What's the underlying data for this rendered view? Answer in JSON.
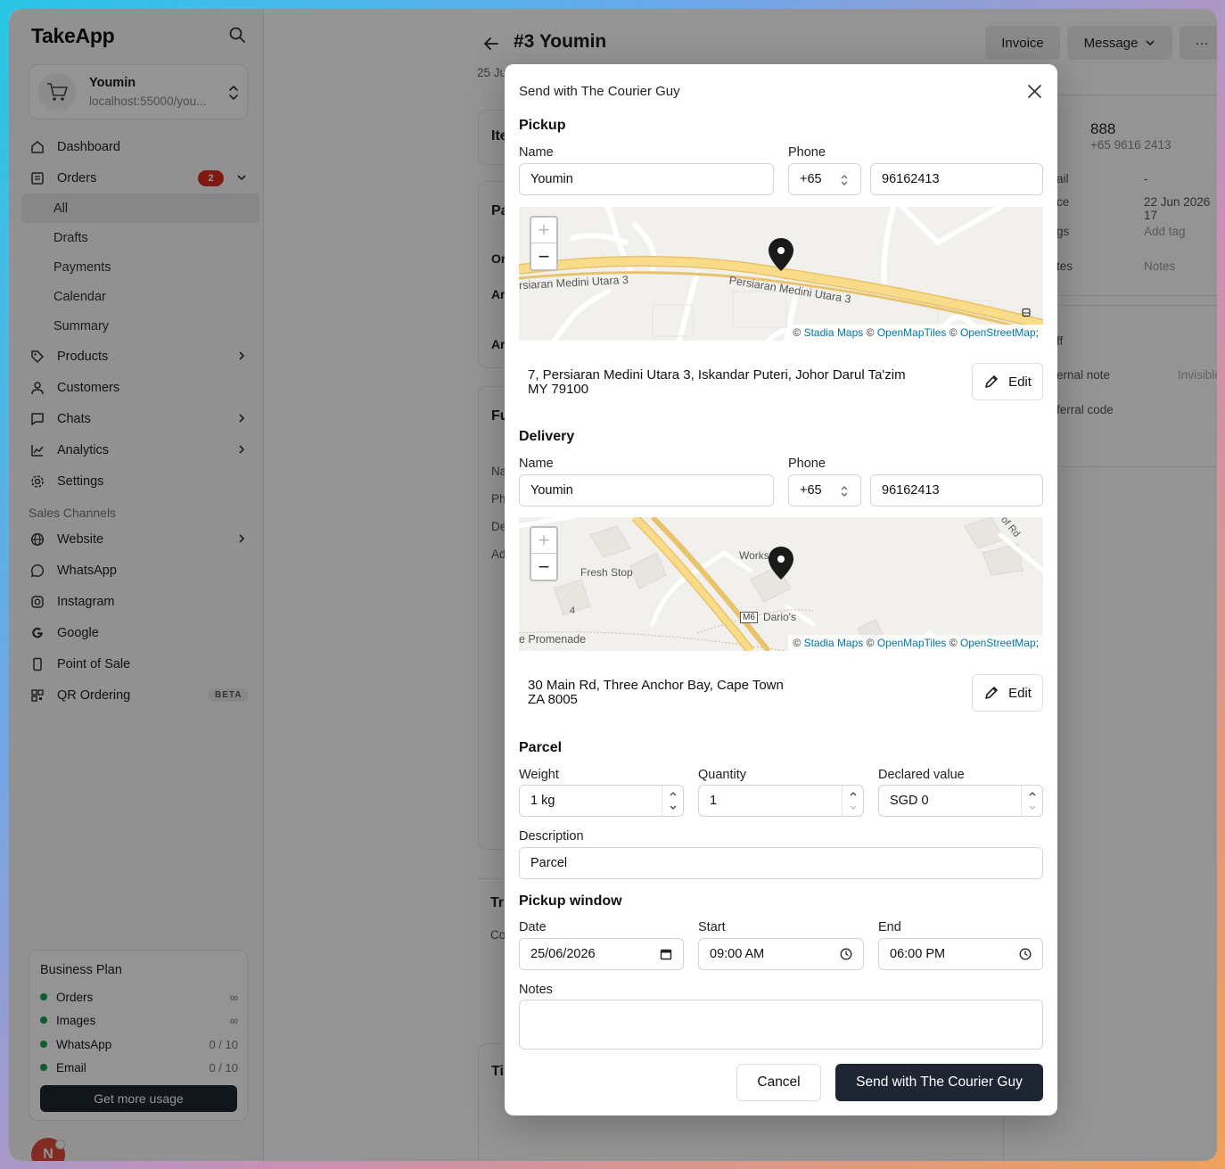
{
  "sidebar": {
    "brand": "TakeApp",
    "store": {
      "name": "Youmin",
      "url": "localhost:55000/you..."
    },
    "nav": [
      {
        "label": "Dashboard",
        "icon": "home-icon"
      },
      {
        "label": "Orders",
        "icon": "orders-icon",
        "badge": "2"
      },
      {
        "label": "Products",
        "icon": "tag-icon"
      },
      {
        "label": "Customers",
        "icon": "user-icon"
      },
      {
        "label": "Chats",
        "icon": "chat-icon"
      },
      {
        "label": "Analytics",
        "icon": "chart-icon"
      },
      {
        "label": "Settings",
        "icon": "gear-icon"
      }
    ],
    "orders_sub": [
      "All",
      "Drafts",
      "Payments",
      "Calendar",
      "Summary"
    ],
    "channels_label": "Sales Channels",
    "channels": [
      {
        "label": "Website",
        "icon": "globe-icon"
      },
      {
        "label": "WhatsApp",
        "icon": "whatsapp-icon"
      },
      {
        "label": "Instagram",
        "icon": "instagram-icon"
      },
      {
        "label": "Google",
        "icon": "google-icon"
      },
      {
        "label": "Point of Sale",
        "icon": "phone-icon"
      },
      {
        "label": "QR Ordering",
        "icon": "qr-icon",
        "badge": "BETA"
      }
    ],
    "plan": {
      "title": "Business Plan",
      "rows": [
        {
          "label": "Orders",
          "value": "∞"
        },
        {
          "label": "Images",
          "value": "∞"
        },
        {
          "label": "WhatsApp",
          "value": "0 / 10"
        },
        {
          "label": "Email",
          "value": "0 / 10"
        }
      ],
      "button": "Get more usage"
    },
    "user_initial": "N"
  },
  "main": {
    "title": "#3 Youmin",
    "date": "25 Ju",
    "buttons": {
      "invoice": "Invoice",
      "message": "Message",
      "more": "···"
    },
    "customer": {
      "name": "888",
      "phone": "+65 9616 2413"
    },
    "details": [
      {
        "label": "ail",
        "value": "-"
      },
      {
        "label": "ce",
        "value": "22 Jun 2026 17"
      },
      {
        "label": "gs",
        "value": "Add tag"
      },
      {
        "label": "tes",
        "value": "Notes"
      }
    ],
    "extra": {
      "staff": "ff",
      "internal": "ernal note",
      "invisible": "Invisible",
      "referral": "ferral code"
    },
    "fragments": [
      "Ite",
      "Pa",
      "Or",
      "Ar",
      "Ar",
      "Fu",
      "Na",
      "Ph",
      "De",
      "Ad",
      "Tr",
      "Co",
      "Tir"
    ]
  },
  "modal": {
    "title": "Send with The Courier Guy",
    "pickup": {
      "heading": "Pickup",
      "name_label": "Name",
      "name": "Youmin",
      "phone_label": "Phone",
      "country_code": "+65",
      "phone": "96162413",
      "map_labels": [
        "rsiaran Medini Utara 3",
        "Persiaran Medini Utara 3"
      ],
      "address_line1": "7, Persiaran Medini Utara 3, Iskandar Puteri, Johor Darul Ta'zim",
      "address_line2": "MY 79100",
      "edit": "Edit"
    },
    "delivery": {
      "heading": "Delivery",
      "name_label": "Name",
      "name": "Youmin",
      "phone_label": "Phone",
      "country_code": "+65",
      "phone": "96162413",
      "map_labels": [
        "Fresh Stop",
        "Works",
        "Dario's",
        "M6",
        "4",
        "e Promenade",
        "of Rd"
      ],
      "address_line1": "30 Main Rd, Three Anchor Bay, Cape Town",
      "address_line2": "ZA 8005",
      "edit": "Edit"
    },
    "map_attribution": {
      "prefix": "©",
      "stadia": "Stadia Maps",
      "omt": "OpenMapTiles",
      "osm": "OpenStreetMap"
    },
    "parcel": {
      "heading": "Parcel",
      "weight_label": "Weight",
      "weight": "1 kg",
      "quantity_label": "Quantity",
      "quantity": "1",
      "declared_label": "Declared value",
      "declared": "SGD 0",
      "description_label": "Description",
      "description": "Parcel"
    },
    "window": {
      "heading": "Pickup window",
      "date_label": "Date",
      "date": "25/06/2026",
      "start_label": "Start",
      "start": "09:00 AM",
      "end_label": "End",
      "end": "06:00 PM"
    },
    "notes_label": "Notes",
    "notes": "",
    "cancel": "Cancel",
    "submit": "Send with The Courier Guy"
  }
}
